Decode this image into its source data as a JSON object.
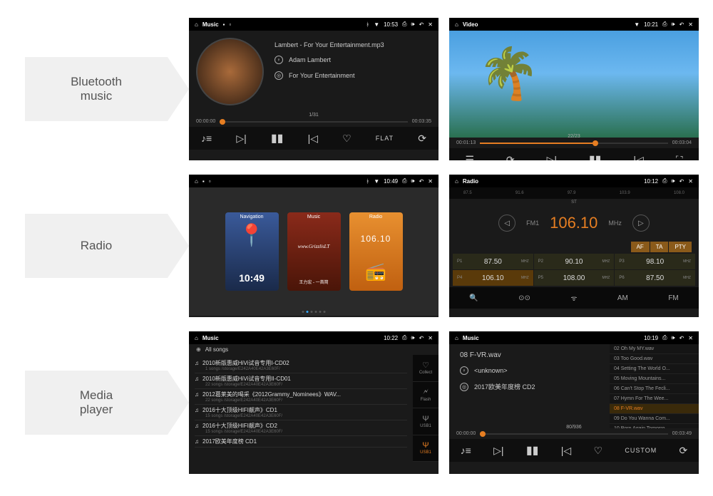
{
  "labels": {
    "bluetooth": "Bluetooth\nmusic",
    "radio": "Radio",
    "media": "Media\nplayer"
  },
  "bt_music": {
    "status": {
      "title": "Music",
      "time": "10:53"
    },
    "track": "Lambert - For Your Entertainment.mp3",
    "artist": "Adam Lambert",
    "album": "For Your Entertainment",
    "elapsed": "00:00:00",
    "total": "00:03:35",
    "count": "1/31",
    "eq": "FLAT"
  },
  "video": {
    "status": {
      "title": "Video",
      "time": "10:21"
    },
    "elapsed": "00:01:13",
    "total": "00:03:04",
    "count": "22/23"
  },
  "home": {
    "status": {
      "time": "10:49"
    },
    "cards": {
      "nav": "Navigation",
      "music": "Music",
      "radio": "Radio",
      "freq": "106.10",
      "time": "10:49",
      "art": "www.GrizzlisLT",
      "sub": "王力宏 - 一首简"
    }
  },
  "radio": {
    "status": {
      "title": "Radio",
      "time": "10:12"
    },
    "scale": [
      "87.5",
      "91.6",
      "97.9",
      "103.9",
      "108.0"
    ],
    "fm": "FM1",
    "freq": "106.10",
    "mhz": "MHz",
    "st": "ST",
    "aftapty": [
      "AF",
      "TA",
      "PTY"
    ],
    "presets": [
      {
        "n": "P1",
        "f": "87.50"
      },
      {
        "n": "P2",
        "f": "90.10"
      },
      {
        "n": "P3",
        "f": "98.10"
      },
      {
        "n": "P4",
        "f": "106.10"
      },
      {
        "n": "P5",
        "f": "108.00"
      },
      {
        "n": "P6",
        "f": "87.50"
      }
    ],
    "mhz_s": "MHZ",
    "bot": {
      "am": "AM",
      "fm": "FM"
    }
  },
  "media_list": {
    "status": {
      "title": "Music",
      "time": "10:22"
    },
    "header": "All songs",
    "items": [
      {
        "t": "2010新版惠威HiVi试音专用I-CD02",
        "s": "1 songs /storage/E242A40E42A3E60F/"
      },
      {
        "t": "2010新版惠威HiVi试音专用II-CD01",
        "s": "22 songs /storage/E242A40E42A3E60F/"
      },
      {
        "t": "2012葛莱美的喝采《2012Grammy_Nominees》WAV...",
        "s": "22 songs /storage/E242A40E42A3E60F/"
      },
      {
        "t": "2016十大顶级HIFI靓声》CD1",
        "s": "15 songs /storage/E242A40E42A3E60F/"
      },
      {
        "t": "2016十大顶级HIFI靓声》CD2",
        "s": "15 songs /storage/E242A40E42A3E60F/"
      },
      {
        "t": "2017欧美年度榜 CD1",
        "s": ""
      }
    ],
    "side": [
      {
        "l": "Collect",
        "i": "♡"
      },
      {
        "l": "Flash",
        "i": "🗲"
      },
      {
        "l": "USB1",
        "i": "Ψ"
      },
      {
        "l": "USB1",
        "i": "Ψ"
      }
    ]
  },
  "media_np": {
    "status": {
      "title": "Music",
      "time": "10:19"
    },
    "track": "08 F-VR.wav",
    "artist": "<unknown>",
    "album": "2017欧美年度榜 CD2",
    "elapsed": "00:00:00",
    "total": "00:03:49",
    "count": "80/936",
    "eq": "CUSTOM",
    "playlist": [
      "02 Oh My MY.wav",
      "03 Too Good.wav",
      "04 Setting The World O...",
      "05 Moving Mountains...",
      "06 Can't Stop The Fecli...",
      "07 Hymn For The Wee...",
      "08 F-VR.wav",
      "09 Do You Wanna Com...",
      "10 Born Again Tomorro..."
    ]
  }
}
